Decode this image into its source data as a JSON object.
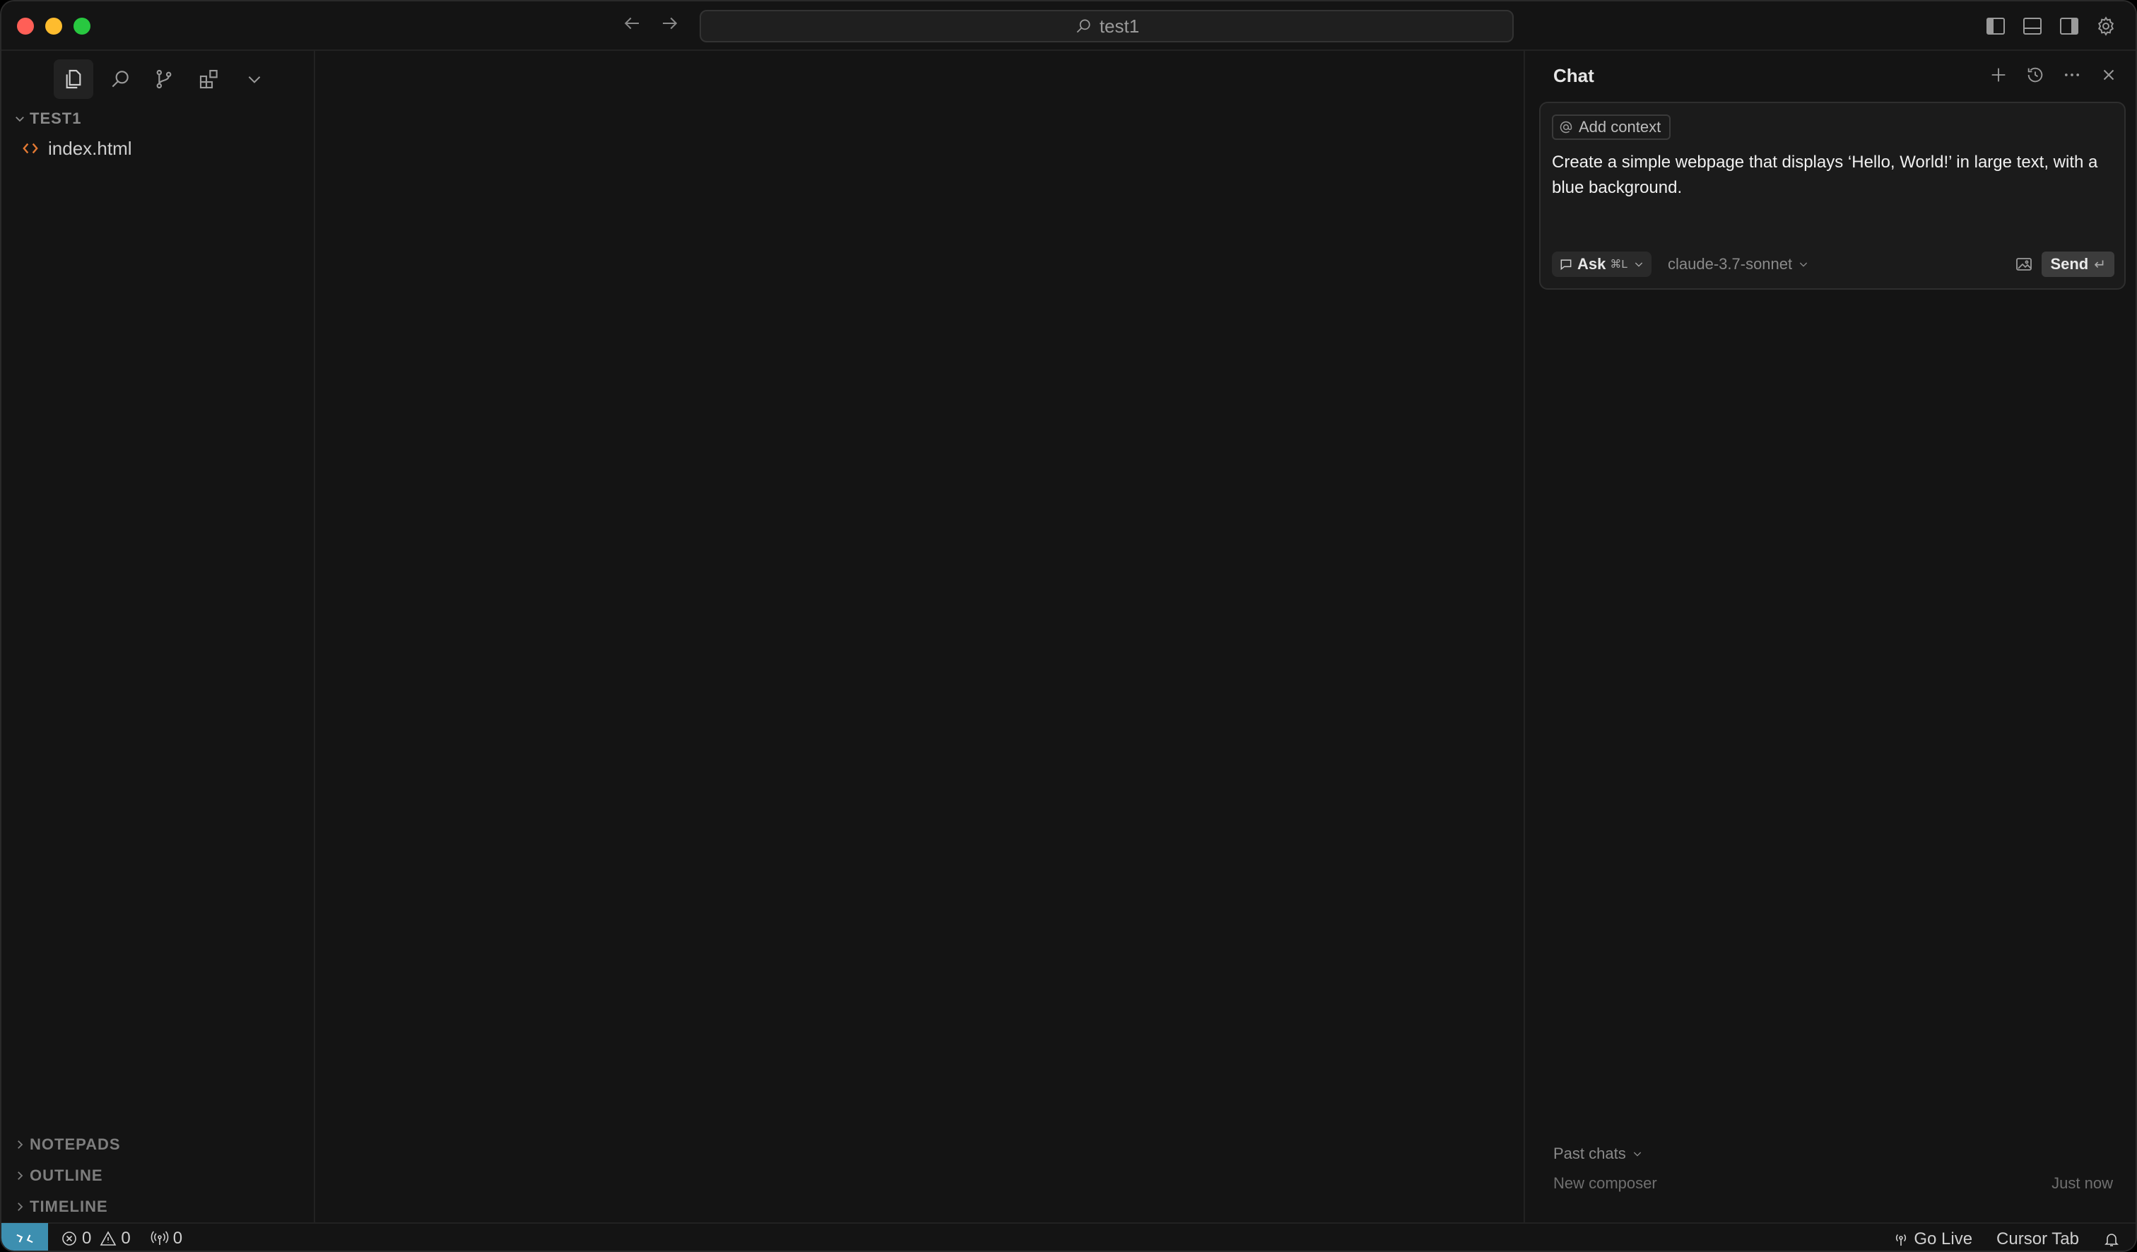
{
  "titlebar": {
    "search_text": "test1"
  },
  "sidebar": {
    "tree_title": "TEST1",
    "files": [
      {
        "name": "index.html",
        "icon": "html-file-icon",
        "color": "#e37933"
      }
    ],
    "sections": [
      "NOTEPADS",
      "OUTLINE",
      "TIMELINE"
    ]
  },
  "chat": {
    "title": "Chat",
    "add_context_label": "Add context",
    "prompt_text": "Create a simple webpage that displays ‘Hello, World!’ in large text, with a blue background.",
    "mode_label": "Ask",
    "mode_shortcut": "⌘L",
    "model": "claude-3.7-sonnet",
    "send_label": "Send",
    "send_shortcut": "↵",
    "past_chats_label": "Past chats",
    "past_items": [
      {
        "title": "New composer",
        "time": "Just now"
      }
    ]
  },
  "statusbar": {
    "errors": "0",
    "warnings": "0",
    "ports": "0",
    "go_live_label": "Go Live",
    "cursor_tab_label": "Cursor Tab",
    "remote_color": "#3d8fb0"
  }
}
